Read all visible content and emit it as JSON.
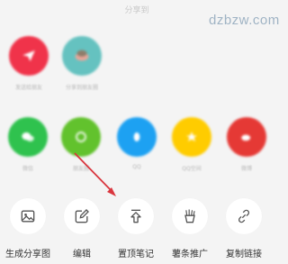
{
  "sheet": {
    "title": "分享到"
  },
  "watermark": {
    "text": "dzbzw.com"
  },
  "share_row1": [
    {
      "label": "发送给朋友",
      "color": "#f0334a",
      "icon": "send-icon"
    },
    {
      "label": "分享到朋友圈",
      "color": "#65c2c0",
      "icon": "avatar-icon"
    }
  ],
  "share_row2": [
    {
      "label": "微信",
      "color": "#2fc24e",
      "icon": "wechat-icon"
    },
    {
      "label": "朋友圈",
      "color": "#62c22d",
      "icon": "moments-icon"
    },
    {
      "label": "QQ",
      "color": "#1da1f2",
      "icon": "qq-icon"
    },
    {
      "label": "QQ空间",
      "color": "#ffcc00",
      "icon": "qzone-icon"
    },
    {
      "label": "微博",
      "color": "#e53935",
      "icon": "weibo-icon"
    }
  ],
  "actions": [
    {
      "label": "生成分享图",
      "icon": "image-icon"
    },
    {
      "label": "编辑",
      "icon": "edit-icon"
    },
    {
      "label": "置顶笔记",
      "icon": "pin-top-icon"
    },
    {
      "label": "薯条推广",
      "icon": "fries-icon"
    },
    {
      "label": "复制链接",
      "icon": "link-icon"
    }
  ],
  "colors": {
    "accent_arrow": "#d9363e",
    "icon_stroke": "#555555"
  }
}
